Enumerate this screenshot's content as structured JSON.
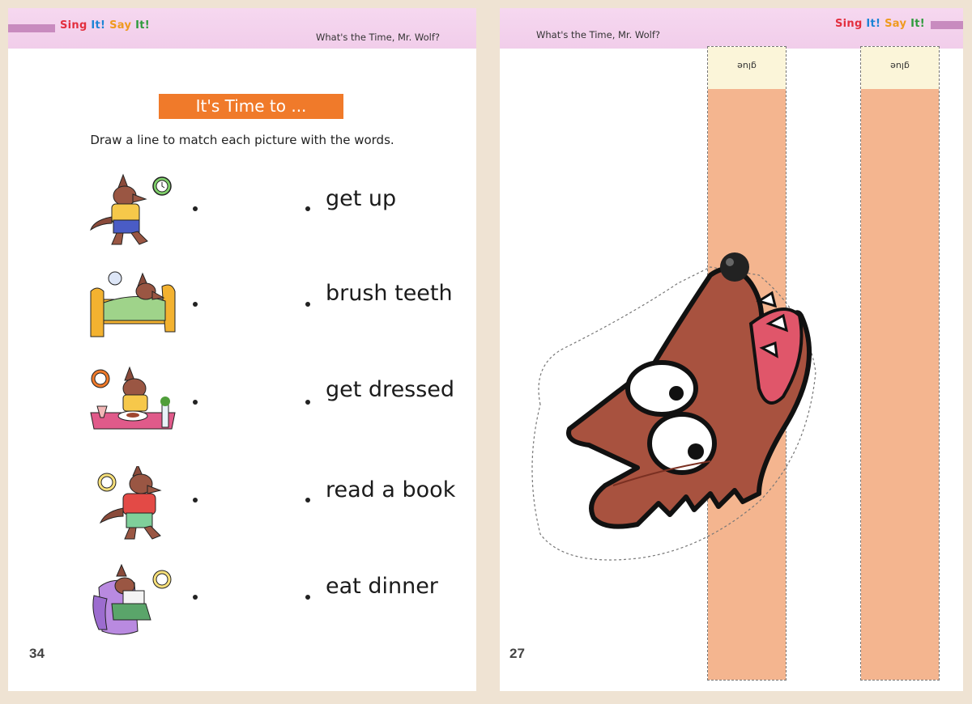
{
  "left_page": {
    "header": {
      "brand": [
        "Sing ",
        "It! ",
        "Say ",
        "It!"
      ],
      "song_title": "What's the Time, Mr. Wolf?"
    },
    "activity": {
      "title": "It's Time to ...",
      "instruction": "Draw a line to match each picture with the words."
    },
    "pictures": [
      {
        "icon": "wolf-waking-with-alarm-clock"
      },
      {
        "icon": "wolf-in-bed-with-clock"
      },
      {
        "icon": "wolf-at-dinner-table"
      },
      {
        "icon": "wolf-getting-dressed"
      },
      {
        "icon": "wolf-reading-in-armchair"
      }
    ],
    "words": [
      "get up",
      "brush teeth",
      "get dressed",
      "read a book",
      "eat dinner"
    ],
    "page_number": "34"
  },
  "right_page": {
    "header": {
      "brand": [
        "Sing ",
        "It! ",
        "Say ",
        "It!"
      ],
      "song_title": "What's the Time, Mr. Wolf?"
    },
    "strips": [
      {
        "glue_label": "glue"
      },
      {
        "glue_label": "glue"
      }
    ],
    "cutout": {
      "icon": "wolf-head-cutout"
    },
    "page_number": "27"
  },
  "colors": {
    "title_banner": "#f07a2a",
    "header_band": "#f3d2ec",
    "strip_fill": "#f4b58f",
    "wolf_brown": "#a8523f"
  }
}
